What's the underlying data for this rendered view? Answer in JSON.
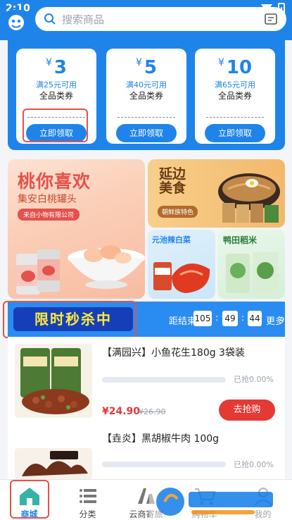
{
  "status_bar": {
    "time": "2:10"
  },
  "search": {
    "placeholder": "搜索商品"
  },
  "colors": {
    "primary": "#1f84ea",
    "accent_red": "#e53935",
    "flash_label_bg": "#153fb8",
    "flash_label_text": "#ffeb3b"
  },
  "coupons": [
    {
      "currency": "¥",
      "amount": "3",
      "condition": "满25元可用",
      "type": "全品类券",
      "button": "立即领取"
    },
    {
      "currency": "¥",
      "amount": "5",
      "condition": "满40元可用",
      "type": "全品类券",
      "button": "立即领取"
    },
    {
      "currency": "¥",
      "amount": "10",
      "condition": "满65元可用",
      "type": "全品类券",
      "button": "立即领取"
    }
  ],
  "banners": {
    "big": {
      "title": "桃你喜欢",
      "subtitle": "集安白桃罐头",
      "tag": "来自小物有限公司"
    },
    "top_right": {
      "title_line1": "延边",
      "title_line2": "美食",
      "tag": "朝鲜族特色"
    },
    "bottom_left": {
      "title": "元池辣白菜"
    },
    "bottom_right": {
      "title": "鸭田稻米"
    }
  },
  "flash_sale": {
    "label": "限时秒杀中",
    "countdown_label": "距结束",
    "hours": "105",
    "minutes": "49",
    "seconds": "44",
    "more": "更多"
  },
  "products": [
    {
      "name": "【满园兴】小鱼花生180g 3袋装",
      "price": "¥24.90",
      "original_price": "¥26.90",
      "sold": "已抢0.00%",
      "progress": 0,
      "button": "去抢购"
    },
    {
      "name": "【垚炎】黑胡椒牛肉 100g",
      "sold": "已抢0.00%",
      "progress": 0
    }
  ],
  "bottom_nav": [
    {
      "label": "商城",
      "icon": "home-icon",
      "active": true
    },
    {
      "label": "分类",
      "icon": "list-icon",
      "active": false
    },
    {
      "label": "云商寄旅",
      "icon": "travel-icon",
      "active": false
    },
    {
      "label": "购物车",
      "icon": "cart-icon",
      "active": false
    },
    {
      "label": "我的",
      "icon": "user-icon",
      "active": false
    }
  ]
}
